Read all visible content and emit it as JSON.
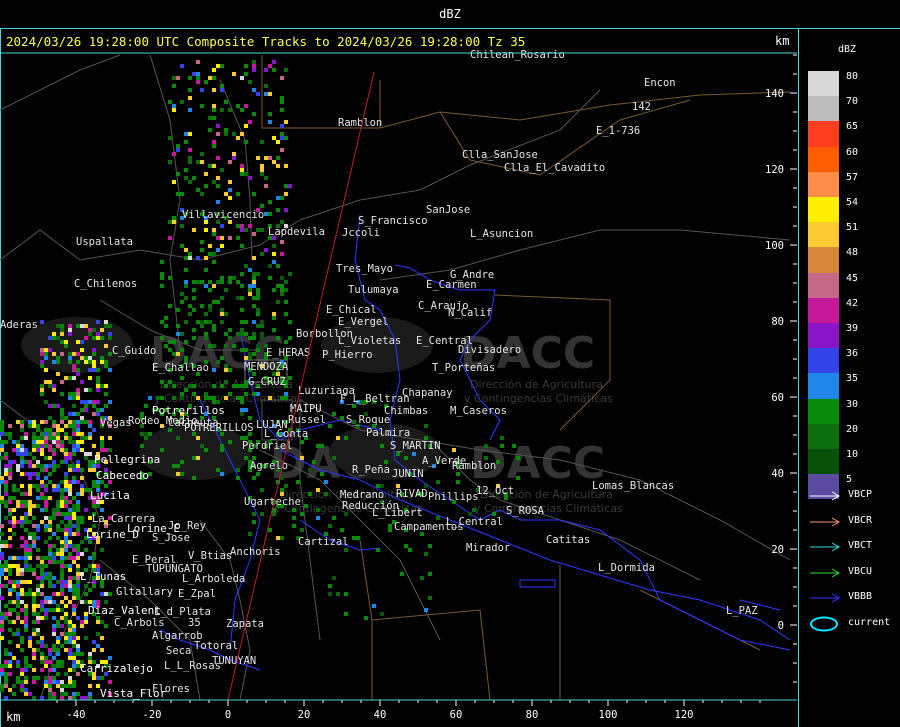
{
  "topbar": {
    "title": "dBZ"
  },
  "header": {
    "text": "2024/03/26 19:28:00 UTC Composite Tracks to 2024/03/26 19:28:00 Tz 35"
  },
  "axis": {
    "unit_top": "km",
    "unit_bottom": "km",
    "x_ticks": [
      "-40",
      "-20",
      "0",
      "20",
      "40",
      "60",
      "80",
      "100",
      "120"
    ],
    "y_ticks": [
      "140",
      "120",
      "100",
      "80",
      "60",
      "40",
      "20",
      "0"
    ]
  },
  "watermark": {
    "brand": "DACC",
    "sub1": "Dirección de Agricultura",
    "sub2": "y Contingencias Climáticas"
  },
  "places": [
    {
      "name": "Ramblon"
    },
    {
      "name": "Encon"
    },
    {
      "name": "142"
    },
    {
      "name": "E_1-736"
    },
    {
      "name": "Clla_SanJose"
    },
    {
      "name": "Clla_El_Cavadito"
    },
    {
      "name": "SanJose"
    },
    {
      "name": "S_Francisco"
    },
    {
      "name": "Jccoli"
    },
    {
      "name": "L_Asuncion"
    },
    {
      "name": "Villavicencio"
    },
    {
      "name": "Uspallata"
    },
    {
      "name": "Lapdevila"
    },
    {
      "name": "Tres_Mayo"
    },
    {
      "name": "G_Andre"
    },
    {
      "name": "Tulumaya"
    },
    {
      "name": "E_Carmen"
    },
    {
      "name": "C_Chilenos"
    },
    {
      "name": "E_Chical"
    },
    {
      "name": "C_Araujo"
    },
    {
      "name": "E_Vergel"
    },
    {
      "name": "N_Calif"
    },
    {
      "name": "Borbollon"
    },
    {
      "name": "L_Violetas"
    },
    {
      "name": "E_Central"
    },
    {
      "name": "C_Guido"
    },
    {
      "name": "E_HERAS"
    },
    {
      "name": "P_Hierro"
    },
    {
      "name": "Divisadero"
    },
    {
      "name": "MENDOZA"
    },
    {
      "name": "E_Challao"
    },
    {
      "name": "G_CRUZ"
    },
    {
      "name": "T_Porteñas"
    },
    {
      "name": "Luzuriaga"
    },
    {
      "name": "Chapanay"
    },
    {
      "name": "F_L_Beltran"
    },
    {
      "name": "MAIPU"
    },
    {
      "name": "Chimbas"
    },
    {
      "name": "M_Caseros"
    },
    {
      "name": "Potrerillos"
    },
    {
      "name": "Vegas"
    },
    {
      "name": "Rodeo_Medio"
    },
    {
      "name": "Cacheuta"
    },
    {
      "name": "LUJAN"
    },
    {
      "name": "S_Roque"
    },
    {
      "name": "Russel"
    },
    {
      "name": "L_Conta"
    },
    {
      "name": "Palmira"
    },
    {
      "name": "POTRERILLOS"
    },
    {
      "name": "S_MARTIN"
    },
    {
      "name": "Perdriel"
    },
    {
      "name": "Pellegrina"
    },
    {
      "name": "A_Verde"
    },
    {
      "name": "Agrelo"
    },
    {
      "name": "R_Peña"
    },
    {
      "name": "JUNIN"
    },
    {
      "name": "Ramblon"
    },
    {
      "name": "Cabecedo"
    },
    {
      "name": "12_Oct"
    },
    {
      "name": "Lomas_Blancas"
    },
    {
      "name": "RIVAD"
    },
    {
      "name": "Phillips"
    },
    {
      "name": "Lucila"
    },
    {
      "name": "Medrano"
    },
    {
      "name": "Ugarteche"
    },
    {
      "name": "Reducción"
    },
    {
      "name": "S_ROSA"
    },
    {
      "name": "La_Carrera"
    },
    {
      "name": "L_Libert"
    },
    {
      "name": "Campamentos"
    },
    {
      "name": "L_Central"
    },
    {
      "name": "Lorine_E"
    },
    {
      "name": "Jo_Rey"
    },
    {
      "name": "Lorine_D"
    },
    {
      "name": "S_Jose"
    },
    {
      "name": "Cartizal"
    },
    {
      "name": "Catitas"
    },
    {
      "name": "Mirador"
    },
    {
      "name": "E_Peral"
    },
    {
      "name": "V_Btias"
    },
    {
      "name": "Anchoris"
    },
    {
      "name": "TUPUNGATO"
    },
    {
      "name": "L_Dormida"
    },
    {
      "name": "L_Tunas"
    },
    {
      "name": "L_Arboleda"
    },
    {
      "name": "Gltallary"
    },
    {
      "name": "E_Zpal"
    },
    {
      "name": "Diaz_Valent"
    },
    {
      "name": "L_d_Plata"
    },
    {
      "name": "C_Arbols"
    },
    {
      "name": "35"
    },
    {
      "name": "Zapata"
    },
    {
      "name": "L_PAZ"
    },
    {
      "name": "Algarrob"
    },
    {
      "name": "Totoral"
    },
    {
      "name": "Seca"
    },
    {
      "name": "TUNUYAN"
    },
    {
      "name": "Carrizalejo"
    },
    {
      "name": "L_L_Rosas"
    },
    {
      "name": "Flores"
    },
    {
      "name": "Vista_Flor"
    },
    {
      "name": "Aderas"
    },
    {
      "name": "Chilean_Rosario"
    }
  ],
  "legend": {
    "title": "dBZ",
    "scale": [
      {
        "label": "80",
        "color": "#d8d8d8"
      },
      {
        "label": "70",
        "color": "#bcbcbc"
      },
      {
        "label": "65",
        "color": "#ff3d1f"
      },
      {
        "label": "60",
        "color": "#ff5e00"
      },
      {
        "label": "57",
        "color": "#ff8d4a"
      },
      {
        "label": "54",
        "color": "#ffee00"
      },
      {
        "label": "51",
        "color": "#fbc932"
      },
      {
        "label": "48",
        "color": "#d68838"
      },
      {
        "label": "45",
        "color": "#c46888"
      },
      {
        "label": "42",
        "color": "#c41a9a"
      },
      {
        "label": "39",
        "color": "#8a16c8"
      },
      {
        "label": "36",
        "color": "#3344e8"
      },
      {
        "label": "35",
        "color": "#1f86e8"
      },
      {
        "label": "30",
        "color": "#0a8a0a"
      },
      {
        "label": "20",
        "color": "#0c6e0c"
      },
      {
        "label": "10",
        "color": "#0a520a"
      },
      {
        "label": "5",
        "color": "#5a4aa0"
      }
    ],
    "tracks": [
      {
        "label": "VBCP",
        "color": "#ffffff"
      },
      {
        "label": "VBCR",
        "color": "#ff9966"
      },
      {
        "label": "VBCT",
        "color": "#33dddd"
      },
      {
        "label": "VBCU",
        "color": "#33dd33"
      },
      {
        "label": "VBBB",
        "color": "#3333ff"
      },
      {
        "label": "current",
        "color": "#00e6ff"
      }
    ]
  }
}
